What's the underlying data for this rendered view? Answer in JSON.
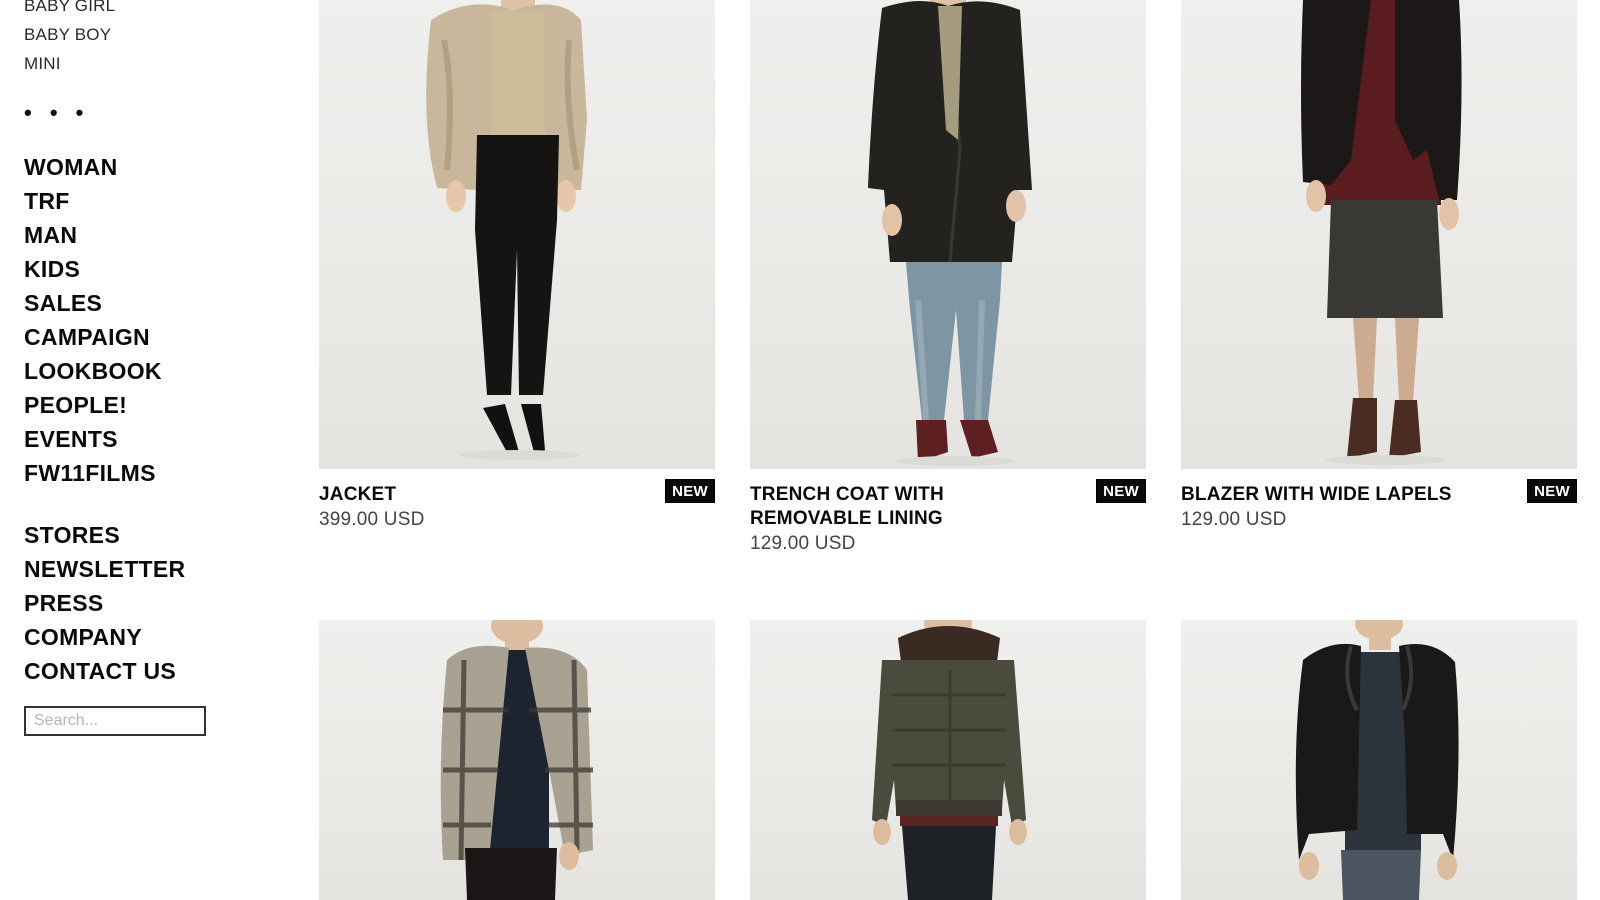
{
  "sidebar": {
    "sub_items": [
      "BABY GIRL",
      "BABY BOY",
      "MINI"
    ],
    "separator": "• • •",
    "main_items": [
      "WOMAN",
      "TRF",
      "MAN",
      "KIDS",
      "SALES",
      "CAMPAIGN",
      "LOOKBOOK",
      "PEOPLE!",
      "EVENTS",
      "FW11FILMS"
    ],
    "info_items": [
      "STORES",
      "NEWSLETTER",
      "PRESS",
      "COMPANY",
      "CONTACT US"
    ],
    "search_placeholder": "Search..."
  },
  "products": [
    {
      "name": "JACKET",
      "price": "399.00 USD",
      "badge": "NEW"
    },
    {
      "name": "TRENCH COAT WITH REMOVABLE LINING",
      "price": "129.00 USD",
      "badge": "NEW"
    },
    {
      "name": "BLAZER WITH WIDE LAPELS",
      "price": "129.00 USD",
      "badge": "NEW"
    },
    {
      "name": "",
      "price": "",
      "badge": ""
    },
    {
      "name": "",
      "price": "",
      "badge": ""
    },
    {
      "name": "",
      "price": "",
      "badge": ""
    }
  ],
  "colors": {
    "text": "#0a0a0a",
    "badge_bg": "#0a0a0a",
    "badge_text": "#ffffff",
    "photo_bg": "#ebeae7"
  }
}
